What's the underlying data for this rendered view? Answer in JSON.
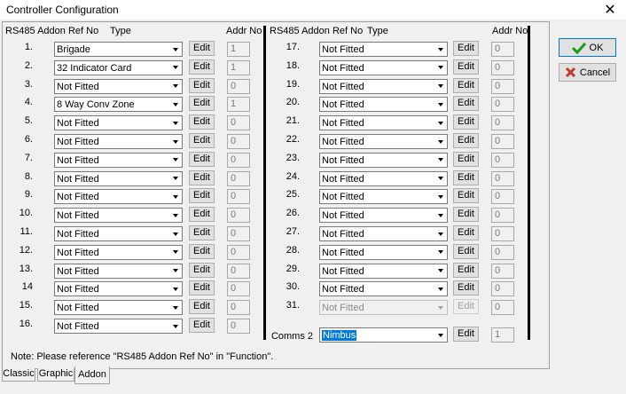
{
  "window": {
    "title": "Controller Configuration",
    "close_glyph": "✕"
  },
  "headers": {
    "left": {
      "ref": "RS485 Addon Ref No",
      "type": "Type",
      "addr": "Addr No"
    },
    "right": {
      "ref": "RS485 Addon Ref No",
      "type": "Type",
      "addr": "Addr No"
    }
  },
  "left_rows": [
    {
      "num": "1.",
      "type": "Brigade",
      "edit": "Edit",
      "addr": "1"
    },
    {
      "num": "2.",
      "type": "32 Indicator Card",
      "edit": "Edit",
      "addr": "1"
    },
    {
      "num": "3.",
      "type": "Not Fitted",
      "edit": "Edit",
      "addr": "0"
    },
    {
      "num": "4.",
      "type": "8 Way Conv Zone",
      "edit": "Edit",
      "addr": "1"
    },
    {
      "num": "5.",
      "type": "Not Fitted",
      "edit": "Edit",
      "addr": "0"
    },
    {
      "num": "6.",
      "type": "Not Fitted",
      "edit": "Edit",
      "addr": "0"
    },
    {
      "num": "7.",
      "type": "Not Fitted",
      "edit": "Edit",
      "addr": "0"
    },
    {
      "num": "8.",
      "type": "Not Fitted",
      "edit": "Edit",
      "addr": "0"
    },
    {
      "num": "9.",
      "type": "Not Fitted",
      "edit": "Edit",
      "addr": "0"
    },
    {
      "num": "10.",
      "type": "Not Fitted",
      "edit": "Edit",
      "addr": "0"
    },
    {
      "num": "11.",
      "type": "Not Fitted",
      "edit": "Edit",
      "addr": "0"
    },
    {
      "num": "12.",
      "type": "Not Fitted",
      "edit": "Edit",
      "addr": "0"
    },
    {
      "num": "13.",
      "type": "Not Fitted",
      "edit": "Edit",
      "addr": "0"
    },
    {
      "num": "14",
      "type": "Not Fitted",
      "edit": "Edit",
      "addr": "0"
    },
    {
      "num": "15.",
      "type": "Not Fitted",
      "edit": "Edit",
      "addr": "0"
    },
    {
      "num": "16.",
      "type": "Not Fitted",
      "edit": "Edit",
      "addr": "0"
    }
  ],
  "right_rows": [
    {
      "num": "17.",
      "type": "Not Fitted",
      "edit": "Edit",
      "addr": "0"
    },
    {
      "num": "18.",
      "type": "Not Fitted",
      "edit": "Edit",
      "addr": "0"
    },
    {
      "num": "19.",
      "type": "Not Fitted",
      "edit": "Edit",
      "addr": "0"
    },
    {
      "num": "20.",
      "type": "Not Fitted",
      "edit": "Edit",
      "addr": "0"
    },
    {
      "num": "21.",
      "type": "Not Fitted",
      "edit": "Edit",
      "addr": "0"
    },
    {
      "num": "22.",
      "type": "Not Fitted",
      "edit": "Edit",
      "addr": "0"
    },
    {
      "num": "23.",
      "type": "Not Fitted",
      "edit": "Edit",
      "addr": "0"
    },
    {
      "num": "24.",
      "type": "Not Fitted",
      "edit": "Edit",
      "addr": "0"
    },
    {
      "num": "25.",
      "type": "Not Fitted",
      "edit": "Edit",
      "addr": "0"
    },
    {
      "num": "26.",
      "type": "Not Fitted",
      "edit": "Edit",
      "addr": "0"
    },
    {
      "num": "27.",
      "type": "Not Fitted",
      "edit": "Edit",
      "addr": "0"
    },
    {
      "num": "28.",
      "type": "Not Fitted",
      "edit": "Edit",
      "addr": "0"
    },
    {
      "num": "29.",
      "type": "Not Fitted",
      "edit": "Edit",
      "addr": "0"
    },
    {
      "num": "30.",
      "type": "Not Fitted",
      "edit": "Edit",
      "addr": "0"
    },
    {
      "num": "31.",
      "type": "Not Fitted",
      "edit": "Edit",
      "addr": "0",
      "disabled": true
    }
  ],
  "comms": {
    "label": "Comms 2",
    "type": "Nimbus",
    "edit": "Edit",
    "addr": "1"
  },
  "note": "Note: Please reference \"RS485 Addon Ref No\" in \"Function\".",
  "buttons": {
    "ok": "OK",
    "cancel": "Cancel"
  },
  "tabs": [
    {
      "label": "Classic",
      "active": false
    },
    {
      "label": "Graphic",
      "active": false
    },
    {
      "label": "Addon",
      "active": true
    }
  ],
  "colors": {
    "ok_check": "#1a9a1a",
    "cancel_x": "#c0392b",
    "selection": "#0078d7"
  }
}
